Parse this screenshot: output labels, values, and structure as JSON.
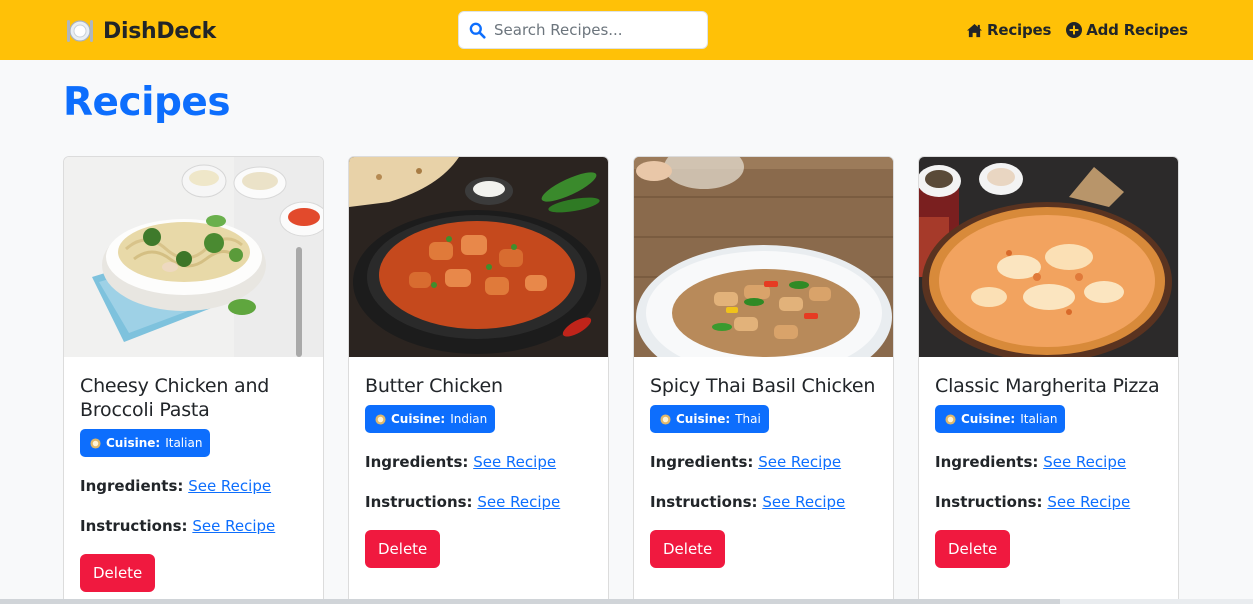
{
  "navbar": {
    "brand": "DishDeck",
    "search_placeholder": "Search Recipes...",
    "links": [
      {
        "label": "Recipes",
        "icon": "home-icon"
      },
      {
        "label": "Add Recipes",
        "icon": "plus-circle-icon"
      }
    ],
    "accent_color": "#ffc107"
  },
  "page": {
    "title": "Recipes",
    "title_color": "#0d6efd"
  },
  "cards": [
    {
      "title": "Cheesy Chicken and Broccoli Pasta",
      "cuisine_label": "Cuisine:",
      "cuisine": "Italian",
      "ingredients_label": "Ingredients:",
      "ingredients_link": "See Recipe",
      "instructions_label": "Instructions:",
      "instructions_link": "See Recipe",
      "delete_label": "Delete"
    },
    {
      "title": "Butter Chicken",
      "cuisine_label": "Cuisine:",
      "cuisine": "Indian",
      "ingredients_label": "Ingredients:",
      "ingredients_link": "See Recipe",
      "instructions_label": "Instructions:",
      "instructions_link": "See Recipe",
      "delete_label": "Delete"
    },
    {
      "title": "Spicy Thai Basil Chicken",
      "cuisine_label": "Cuisine:",
      "cuisine": "Thai",
      "ingredients_label": "Ingredients:",
      "ingredients_link": "See Recipe",
      "instructions_label": "Instructions:",
      "instructions_link": "See Recipe",
      "delete_label": "Delete"
    },
    {
      "title": "Classic Margherita Pizza",
      "cuisine_label": "Cuisine:",
      "cuisine": "Italian",
      "ingredients_label": "Ingredients:",
      "ingredients_link": "See Recipe",
      "instructions_label": "Instructions:",
      "instructions_link": "See Recipe",
      "delete_label": "Delete"
    }
  ],
  "colors": {
    "badge": "#0d6efd",
    "delete": "#f0193f",
    "link": "#0d6efd"
  }
}
